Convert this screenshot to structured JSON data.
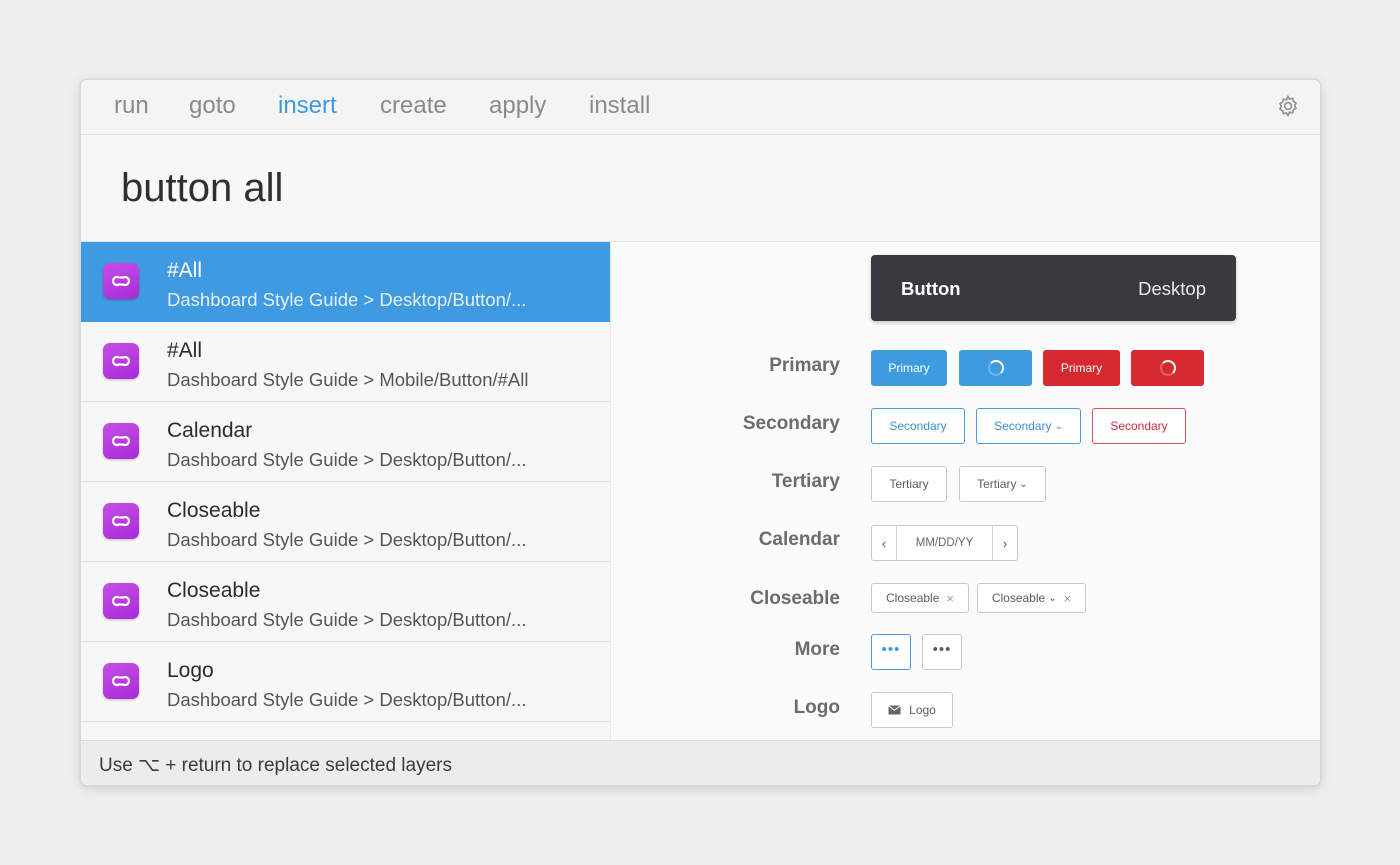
{
  "tabs": [
    {
      "label": "run"
    },
    {
      "label": "goto"
    },
    {
      "label": "insert",
      "active": true
    },
    {
      "label": "create"
    },
    {
      "label": "apply"
    },
    {
      "label": "install"
    }
  ],
  "settings_icon": "gear-icon",
  "search": {
    "value": "button all"
  },
  "results": [
    {
      "title": "#All",
      "path": "Dashboard Style Guide > Desktop/Button/...",
      "selected": true
    },
    {
      "title": "#All",
      "path": "Dashboard Style Guide > Mobile/Button/#All"
    },
    {
      "title": "Calendar",
      "path": "Dashboard Style Guide > Desktop/Button/..."
    },
    {
      "title": "Closeable",
      "path": "Dashboard Style Guide > Desktop/Button/..."
    },
    {
      "title": "Closeable",
      "path": "Dashboard Style Guide > Desktop/Button/..."
    },
    {
      "title": "Logo",
      "path": "Dashboard Style Guide > Desktop/Button/..."
    }
  ],
  "preview": {
    "header_title": "Button",
    "header_platform": "Desktop",
    "rows": {
      "primary": {
        "label": "Primary",
        "btn1": "Primary",
        "btn3": "Primary"
      },
      "secondary": {
        "label": "Secondary",
        "btn1": "Secondary",
        "btn2": "Secondary",
        "btn3": "Secondary"
      },
      "tertiary": {
        "label": "Tertiary",
        "btn1": "Tertiary",
        "btn2": "Tertiary"
      },
      "calendar": {
        "label": "Calendar",
        "date": "MM/DD/YY"
      },
      "closeable": {
        "label": "Closeable",
        "btn1": "Closeable",
        "btn2": "Closeable"
      },
      "more": {
        "label": "More",
        "dots": "•••"
      },
      "logo": {
        "label": "Logo",
        "btn": "Logo"
      }
    },
    "colors": {
      "primary_blue": "#3d9be0",
      "danger_red": "#d62a30",
      "header_dark": "#373b40"
    }
  },
  "footer": {
    "hint": "Use ⌥ + return to replace selected layers"
  }
}
